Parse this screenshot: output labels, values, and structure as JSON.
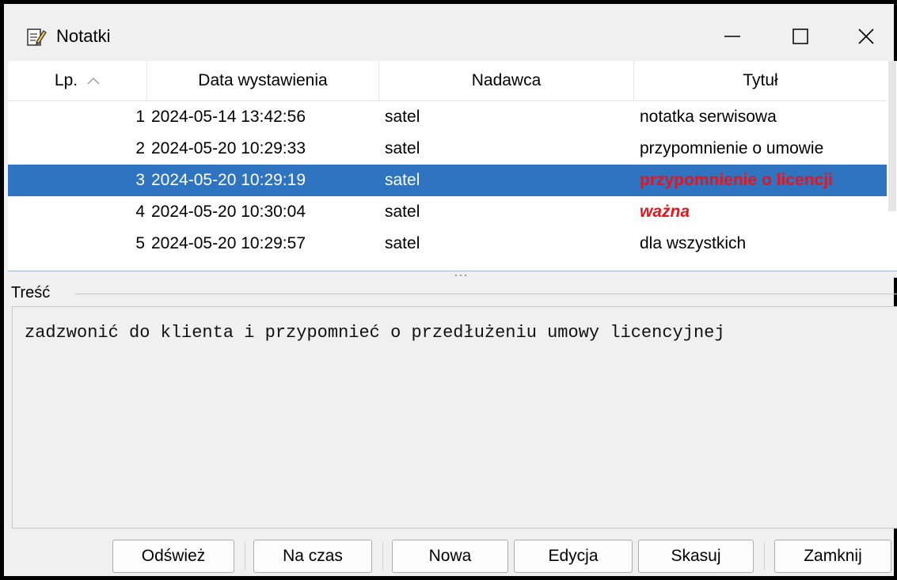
{
  "window": {
    "title": "Notatki",
    "app_icon": "notepad-edit-icon",
    "controls": {
      "minimize": "minimize-icon",
      "maximize": "maximize-icon",
      "close": "close-icon"
    }
  },
  "table": {
    "columns": {
      "lp": "Lp.",
      "date": "Data wystawienia",
      "sender": "Nadawca",
      "title": "Tytuł"
    },
    "sort": {
      "column": "lp",
      "direction": "ascending",
      "icon": "sort-ascending-icon"
    },
    "rows": [
      {
        "lp": "1",
        "date": "2024-05-14 13:42:56",
        "sender": "satel",
        "title": "notatka serwisowa",
        "style": "normal",
        "selected": false
      },
      {
        "lp": "2",
        "date": "2024-05-20 10:29:33",
        "sender": "satel",
        "title": "przypomnienie o umowie",
        "style": "normal",
        "selected": false
      },
      {
        "lp": "3",
        "date": "2024-05-20 10:29:19",
        "sender": "satel",
        "title": "przypomnienie o licencji",
        "style": "red-bold",
        "selected": true
      },
      {
        "lp": "4",
        "date": "2024-05-20 10:30:04",
        "sender": "satel",
        "title": "ważna",
        "style": "red-bold-italic",
        "selected": false
      },
      {
        "lp": "5",
        "date": "2024-05-20 10:29:57",
        "sender": "satel",
        "title": "dla wszystkich",
        "style": "normal",
        "selected": false
      }
    ]
  },
  "content": {
    "label": "Treść",
    "text": "zadzwonić do klienta i przypomnieć o przedłużeniu umowy licencyjnej"
  },
  "buttons": {
    "refresh": "Odśwież",
    "on_time": "Na czas",
    "new": "Nowa",
    "edit": "Edycja",
    "delete": "Skasuj",
    "close": "Zamknij"
  },
  "colors": {
    "selection": "#2f74c0",
    "important_text": "#e8141c"
  }
}
